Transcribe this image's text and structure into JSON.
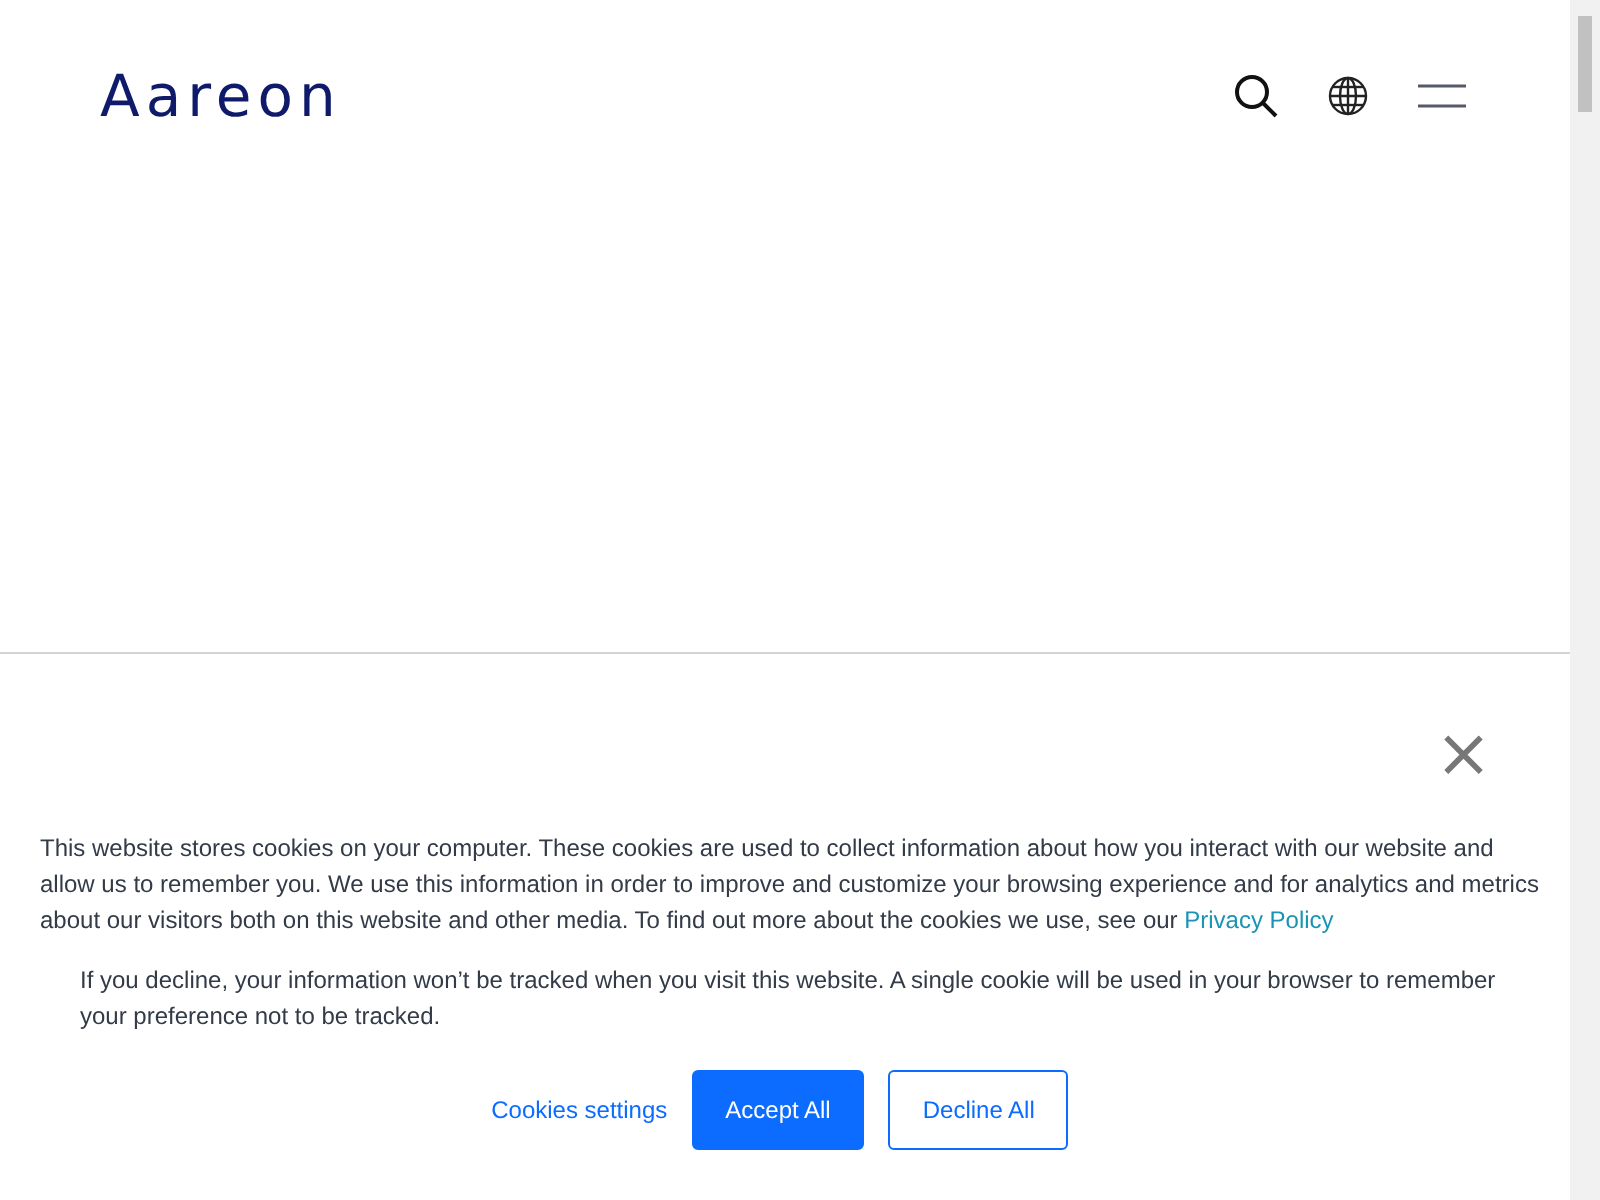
{
  "header": {
    "logo": "Aareon"
  },
  "cookie_banner": {
    "close": "×",
    "message": "This website stores cookies on your computer. These cookies are used to collect information about how you interact with our website and allow us to remember you. We use this information in order to improve and customize your browsing experience and for analytics and metrics about our visitors both on this website and other media. To find out more about the cookies we use, see our",
    "link": "Privacy Policy",
    "decline_note": "If you decline, your information won’t be tracked when you visit this website. A single cookie will be used in your browser to remember your preference not to be tracked.",
    "buttons": [
      {
        "label": "Cookies settings",
        "kind": "link"
      },
      {
        "label": "Accept All",
        "kind": "primary"
      },
      {
        "label": "Decline All",
        "kind": "outline"
      }
    ]
  }
}
